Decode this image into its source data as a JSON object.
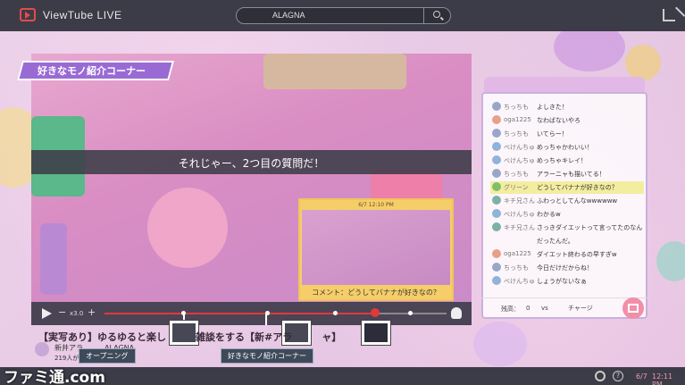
{
  "app": {
    "title": "ViewTube  LIVE"
  },
  "search": {
    "value": "ALAGNA"
  },
  "banner": {
    "text": "好きなモノ紹介コーナー"
  },
  "video": {
    "caption": "それじゃー、2つ目の質問だ！",
    "preview": {
      "time": "6/7 12:10 PM",
      "caption": "コメント：どうしてバナナが好きなの？"
    },
    "speed": "x3.0",
    "progress": 0.79,
    "title": "【実写あり】ゆるゆると楽し　　　雑談をする【新#アラ　　　ャ】",
    "channel": "新井アラ　　　ALAGNA",
    "viewers": "219人が",
    "chapters": [
      "オープニング",
      "好きなモノ紹介コーナー"
    ]
  },
  "chat": {
    "messages": [
      {
        "user": "ちっちも",
        "text": "よしきた！",
        "color": "#9aa6c9",
        "highlight": false
      },
      {
        "user": "oga1225",
        "text": "なわばないやろ",
        "color": "#e8a08a",
        "highlight": false
      },
      {
        "user": "ちっちも",
        "text": "いてらー！",
        "color": "#9aa6c9",
        "highlight": false
      },
      {
        "user": "べけんちゅ",
        "text": "めっちゃかわいい！",
        "color": "#8fb3d9",
        "highlight": false
      },
      {
        "user": "べけんちゅ",
        "text": "めっちゃキレイ！",
        "color": "#8fb3d9",
        "highlight": false
      },
      {
        "user": "ちっちも",
        "text": "アラーニャも描いてる！",
        "color": "#9aa6c9",
        "highlight": false
      },
      {
        "user": "グリーン",
        "text": "どうしてバナナが好きなの？",
        "color": "#7fbf6a",
        "highlight": true
      },
      {
        "user": "キチ兄さん",
        "text": "ふわっとしてんなwwwwww",
        "color": "#7fb0a8",
        "highlight": false
      },
      {
        "user": "べけんちゅ",
        "text": "わかるw",
        "color": "#8fb3d9",
        "highlight": false
      },
      {
        "user": "キチ兄さん",
        "text": "さっきダイエットって言ってたのなん",
        "color": "#7fb0a8",
        "highlight": false
      },
      {
        "user": "",
        "text": "だったんだ。",
        "color": "transparent",
        "highlight": false
      },
      {
        "user": "oga1225",
        "text": "ダイエット終わるの早すぎw",
        "color": "#e8a08a",
        "highlight": false
      },
      {
        "user": "ちっちも",
        "text": "今日だけだからね！",
        "color": "#9aa6c9",
        "highlight": false
      },
      {
        "user": "べけんちゅ",
        "text": "しょうがないなぁ",
        "color": "#8fb3d9",
        "highlight": false
      }
    ],
    "balance_label": "残高：",
    "balance_value": "0",
    "balance_unit": "vs",
    "charge_label": "チャージ"
  },
  "footer": {
    "watermark": "ファミ通.com",
    "date": "6/7",
    "time": "12:11 PM"
  },
  "colors": {
    "accent": "#e03a3a",
    "bar": "#3c3c48",
    "gift": "#f18fa8"
  }
}
